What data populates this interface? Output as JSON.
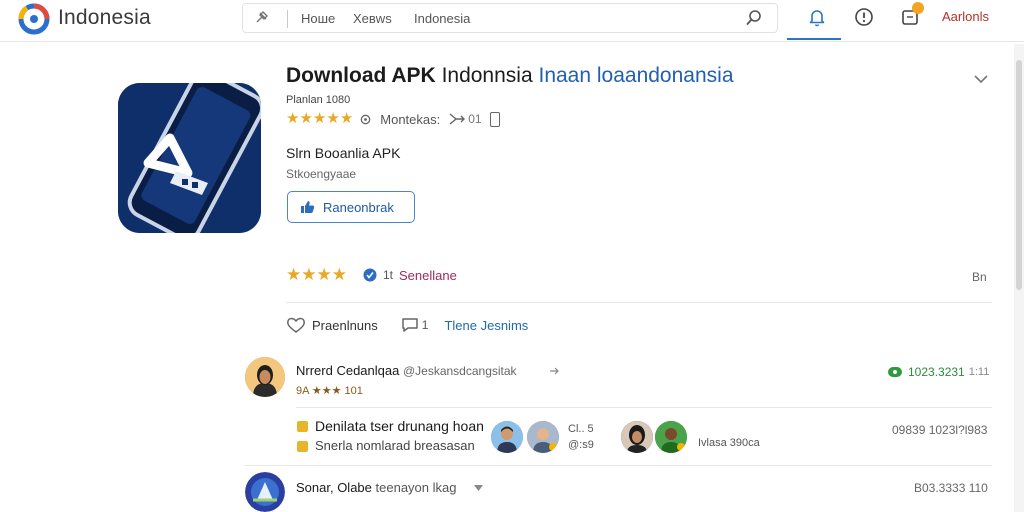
{
  "header": {
    "brand": "Indonesia",
    "nav_links": [
      "Hoше",
      "Xевws",
      "Indonesia"
    ],
    "account": "Aarlonls",
    "colors": {
      "logo_blue": "#2a6fd0",
      "logo_red": "#e04a3f",
      "logo_yellow": "#f4b400",
      "accent": "#2d74c4"
    }
  },
  "app": {
    "title_bold": "Download APK",
    "title_regular": "Indonnsia",
    "title_link": "Inaan loaandonansia",
    "meta": "Planlan 1080",
    "rating_label": "Montekas:",
    "share_count": "01",
    "subtitle": "Slrn Booanlia APK",
    "subtitle2": "Stkoengyaae",
    "recommend_label": "Raneonbrak"
  },
  "rating_summary": {
    "stars": 4,
    "count": "1t",
    "link": "Senellane",
    "right_value": "Bn"
  },
  "actions": {
    "like_label": "Praenlnuns",
    "comment_count": "1",
    "link": "Tlene Jesnims"
  },
  "comments": [
    {
      "name": "Nrrerd Cedanlqaa",
      "handle": "@Jeskansdcangsitak",
      "stars_label": "9A ★★★ 101",
      "badge": "1023.3231",
      "badge_extra": "1:11"
    }
  ],
  "sub_section": {
    "title": "Denilata tser drunang hoan",
    "subtitle": "Snerla nomlarad breasasan",
    "meta1": "Cl.. 5",
    "meta2": "@:s9",
    "meta3": "Ivlasa 390ca",
    "right": "09839 1023l?l983"
  },
  "list_item": {
    "name": "Sonar, Olabe",
    "detail": "teenayon lkag",
    "right": "B03.3333 110"
  }
}
